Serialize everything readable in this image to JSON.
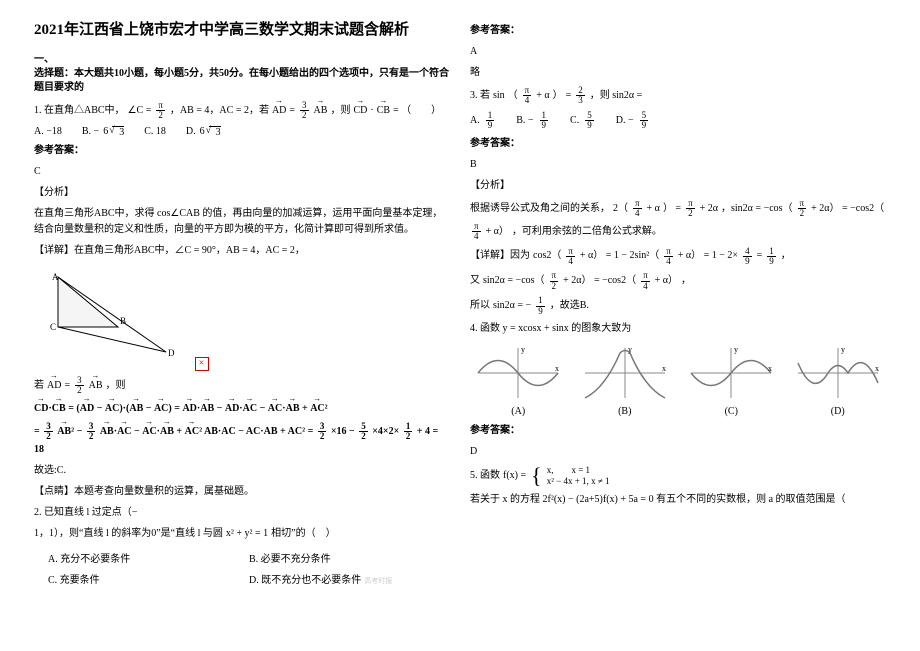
{
  "title": "2021年江西省上饶市宏才中学高三数学文期末试题含解析",
  "section1": {
    "heading_a": "一、",
    "heading_b": "选择题：本大题共10小题，每小题5分，共50分。在每小题给出的四个选项中，只有是一个符合题目要求的"
  },
  "q1": {
    "stem_a": "1. 在直角△ABC中，",
    "angC": "∠C =",
    "pi2_num": "π",
    "pi2_den": "2",
    "ab": "，AB = 4，AC = 2，若",
    "ad_eq": "AD",
    "three_halves_num": "3",
    "three_halves_den": "2",
    "ab2": "AB",
    "then": "，则",
    "cd_cb": "CD·CB",
    "eq_paren": " = （　　）",
    "optA": "A. −18",
    "optB": "B. −",
    "optB_v": "6",
    "optB_rt": "3",
    "optC": "C. 18",
    "optD": "D.",
    "optD_v": "6",
    "optD_rt": "3",
    "ans_label": "参考答案：",
    "ans": "C",
    "analysis_label": "【分析】",
    "analysis": "在直角三角形ABC中，求得 cos∠CAB 的值，再由向量的加减运算，运用平面向量基本定理，结合向量数量积的定义和性质，向量的平方即为模的平方，化简计算即可得到所求值。",
    "detail_label": "【详解】在直角三角形ABC中，∠C = 90°，AB = 4，AC = 2，",
    "if_label": "若",
    "then2": "，则",
    "expand": "CD·CB = (AD − AC)·(AB − AC) = AD·AB − AD·AC − AC·AB + AC²",
    "calc_a_num": "3",
    "calc_a_den": "2",
    "calc_b": "AB² −",
    "calc_b_num": "3",
    "calc_b_den": "2",
    "calc_c": "AB·AC − AC·AB + AC² =",
    "calc_c_num": "3",
    "calc_c_den": "2",
    "calc_d": "×16 −",
    "calc_d_num": "5",
    "calc_d_den": "2",
    "calc_e": "×4×2×",
    "calc_e_num": "1",
    "calc_e_den": "2",
    "calc_f": " + 4 = 18",
    "choose": "故选:C.",
    "point_label": "【点睛】本题考查向量数量积的运算，属基础题。"
  },
  "q2": {
    "stem_a": "2. 已知直线 l 过定点（−",
    "stem_b": "1，1），则“直线 l 的斜率为0”是“直线 l 与圆",
    "circle": "x² + y² = 1",
    "stem_c": "相切”的（　）",
    "optA": "A. 充分不必要条件",
    "optB": "B. 必要不充分条件",
    "optC": "C. 充要条件",
    "optD": "D. 既不充分也不必要条件",
    "watermark": "高考时报",
    "ans_label": "参考答案：",
    "ans": "A",
    "brief": "略"
  },
  "q3": {
    "stem_a": "3. 若",
    "sin_lhs": "sin",
    "pi4_num": "π",
    "pi4_den": "4",
    "plus_a": "+ α",
    "eq": " = ",
    "two_thirds_num": "2",
    "two_thirds_den": "3",
    "then": "，则 sin2α = ",
    "optA_lbl": "A.",
    "optA_num": "1",
    "optA_den": "9",
    "optB_lbl": "B. −",
    "optB_num": "1",
    "optB_den": "9",
    "optC_lbl": "C.",
    "optC_num": "5",
    "optC_den": "9",
    "optD_lbl": "D. −",
    "optD_num": "5",
    "optD_den": "9",
    "ans_label": "参考答案：",
    "ans": "B",
    "analysis_label": "【分析】",
    "analysis_a": "根据诱导公式及角之间的关系，",
    "rel1_num": "π",
    "rel1_den": "4",
    "rel1_b": "+ α",
    "rel2_num": "π",
    "rel2_den": "2",
    "rel2_b": "+ 2α",
    "rel2_txt": "2（",
    "rel_eq": "） = ",
    "rel3": "，sin2α = −cos（",
    "rel3_plus": " + 2α） = −cos2（",
    "rel3_tail": " + α）",
    "rel_end": "，可利用余弦的二倍角公式求解。",
    "detail_label": "【详解】因为",
    "cos2_lhs": "cos2（",
    "cos2_mid": " + α） = 1 − 2sin²（",
    "cos2_rhs": " + α） = 1 − 2×",
    "four_ninths_num": "4",
    "four_ninths_den": "9",
    "cos2_eq": " = ",
    "one_ninth_num": "1",
    "one_ninth_den": "9",
    "cos2_tail": "，",
    "and": "又",
    "sin2a": "sin2α = −cos（",
    "sin2a_mid": " + 2α） = −cos2（",
    "sin2a_tail": " + α）",
    "so": "所以",
    "sin2a_eq": "sin2α = −",
    "final_num": "1",
    "final_den": "9",
    "choose": "，故选B."
  },
  "q4": {
    "stem": "4. 函数 y = xcosx + sinx 的图象大致为",
    "labels": {
      "a": "(A)",
      "b": "(B)",
      "c": "(C)",
      "d": "(D)"
    },
    "ans_label": "参考答案：",
    "ans": "D"
  },
  "q5": {
    "stem_a": "5. 函数",
    "fx": "f(x) =",
    "piece1": "x,",
    "piece1_cond": "x = 1",
    "piece2": "x² − 4x + 1,",
    "piece2_cond": "x ≠ 1",
    "stem_b": "若关于 x 的方程 2f²(x) − (2a+5)f(x) + 5a = 0 有五个不同的实数根，则 a 的取值范围是（"
  }
}
